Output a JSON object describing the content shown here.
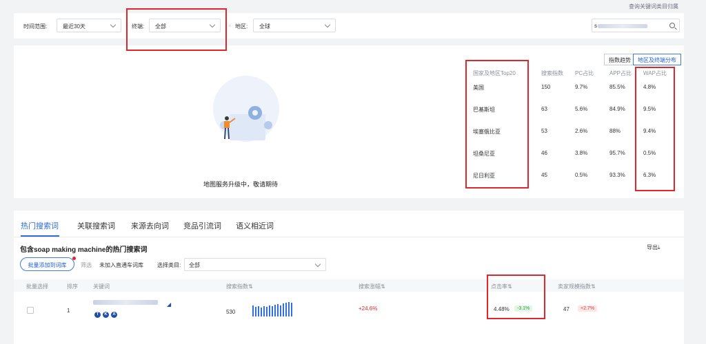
{
  "top_link": "查询关键词类目归属",
  "filters": {
    "time_label": "时间范围:",
    "time_value": "最近30天",
    "terminal_label": "终端:",
    "terminal_value": "全部",
    "region_label": "地区:",
    "region_value": "全球",
    "search_prefix": "s"
  },
  "map_panel": {
    "placeholder_text": "地图服务升级中，敬请期待",
    "buttons": {
      "trend": "指数趋势",
      "region": "地区及终端分布"
    },
    "headers": [
      "国家及地区Top20",
      "搜索指数",
      "PC占比",
      "APP占比",
      "WAP占比"
    ],
    "rows": [
      [
        "美国",
        "150",
        "9.7%",
        "85.5%",
        "4.8%"
      ],
      [
        "巴基斯坦",
        "63",
        "5.6%",
        "84.9%",
        "9.5%"
      ],
      [
        "埃塞俄比亚",
        "53",
        "2.6%",
        "88%",
        "9.4%"
      ],
      [
        "坦桑尼亚",
        "46",
        "3.8%",
        "95.7%",
        "0.5%"
      ],
      [
        "尼日利亚",
        "45",
        "0.5%",
        "93.3%",
        "6.3%"
      ]
    ]
  },
  "tabs": [
    "热门搜索词",
    "关联搜索词",
    "来源去向词",
    "竞品引流词",
    "语义相近词"
  ],
  "section": {
    "title": "包含soap making machine的热门搜索词",
    "export": "导出",
    "batch_add": "批量添加到词库",
    "filter_label": "筛选",
    "not_added": "未加入直通车词库",
    "category_label": "选择类目:",
    "category_value": "全部"
  },
  "table": {
    "headers": {
      "select": "批量选择",
      "rank": "排序",
      "keyword": "关键词",
      "search_index": "搜索指数",
      "search_growth": "搜索涨幅",
      "ctr": "点击率",
      "seller_scale": "卖家规模指数"
    },
    "row": {
      "rank": "1",
      "tags": [
        "T",
        "K",
        "A"
      ],
      "search_index": "530",
      "search_growth": "+24.6%",
      "ctr": "4.48%",
      "ctr_change": "-3.1%",
      "seller_scale": "47",
      "seller_change": "+2.7%"
    }
  },
  "colors": {
    "accent": "#2c6bd8",
    "highlight_box": "#e0262b",
    "positive": "#2e9a45",
    "negative": "#d9363e"
  }
}
